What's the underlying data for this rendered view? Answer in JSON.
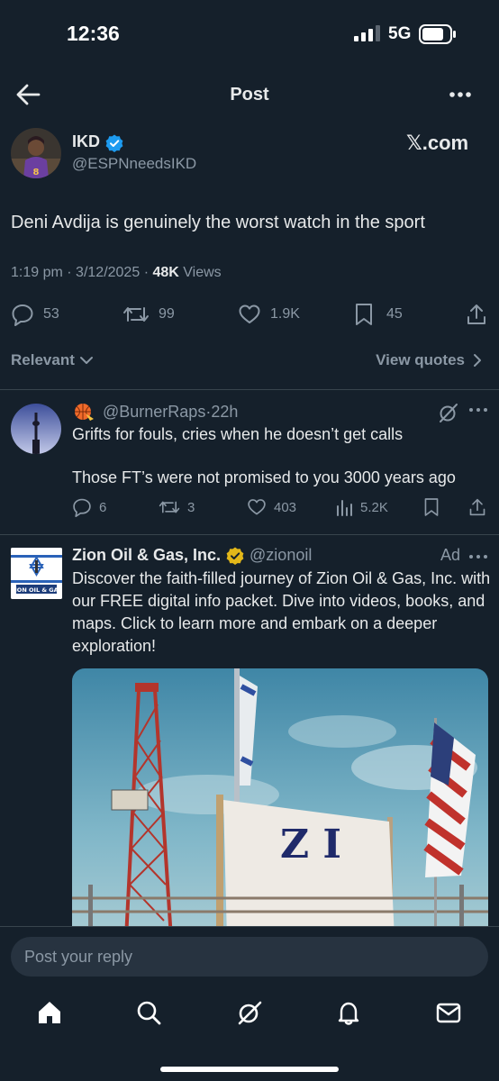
{
  "status_bar": {
    "time": "12:36",
    "network": "5G"
  },
  "header": {
    "title": "Post"
  },
  "post": {
    "author_name": "IKD",
    "author_handle": "@ESPNneedsIKD",
    "source_badge": "𝕏.com",
    "text": "Deni Avdija is genuinely the worst watch in the sport",
    "time": "1:19 pm",
    "date": "3/12/2025",
    "views_count": "48K",
    "views_label": "Views",
    "replies": "53",
    "reposts": "99",
    "likes": "1.9K",
    "bookmarks": "45"
  },
  "sort": {
    "label": "Relevant",
    "view_quotes": "View quotes"
  },
  "reply": {
    "handle": "@BurnerRaps",
    "age": "22h",
    "text_line1": "Grifts for fouls, cries when he doesn’t get calls",
    "text_line2": "Those FT’s were not promised to you 3000 years ago",
    "replies": "6",
    "reposts": "3",
    "likes": "403",
    "views": "5.2K"
  },
  "ad": {
    "name": "Zion Oil & Gas, Inc.",
    "handle": "@zionoil",
    "label": "Ad",
    "text": "Discover the faith-filled journey of Zion Oil & Gas, Inc. with our FREE digital info packet. Dive into videos, books, and maps. Click to learn more and embark on a deeper exploration!",
    "banner_text": "Z I",
    "logo_text": "ZION OIL & GAS"
  },
  "composer": {
    "placeholder": "Post your reply"
  },
  "icons": {
    "nav": [
      "home-icon",
      "search-icon",
      "grok-icon",
      "notifications-icon",
      "messages-icon"
    ],
    "actions": [
      "reply-icon",
      "repost-icon",
      "like-icon",
      "bookmark-icon",
      "share-icon"
    ]
  },
  "colors": {
    "background": "#15202b",
    "verified_blue": "#1d9bf0",
    "verified_gold": "#e2b719",
    "muted": "#8b98a5"
  }
}
